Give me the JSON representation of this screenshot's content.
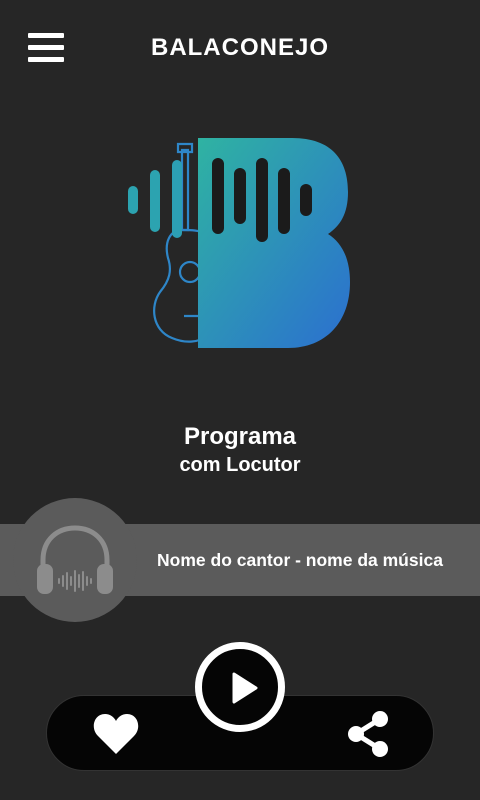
{
  "header": {
    "title": "BALACONEJO",
    "menu_icon": "hamburger-menu-icon"
  },
  "logo": {
    "name": "balaconejo-logo",
    "gradient": [
      "#2fb3a2",
      "#2b6fd0"
    ]
  },
  "program": {
    "title": "Programa",
    "subtitle": "com Locutor"
  },
  "now_playing": {
    "track": "Nome do cantor - nome da música",
    "artwork_icon": "headphones-icon"
  },
  "controls": {
    "like_icon": "heart-icon",
    "play_icon": "play-icon",
    "share_icon": "share-icon"
  },
  "colors": {
    "background": "#262626",
    "track_bar": "#5b5b5b",
    "control_bar": "#050505",
    "foreground": "#ffffff"
  }
}
